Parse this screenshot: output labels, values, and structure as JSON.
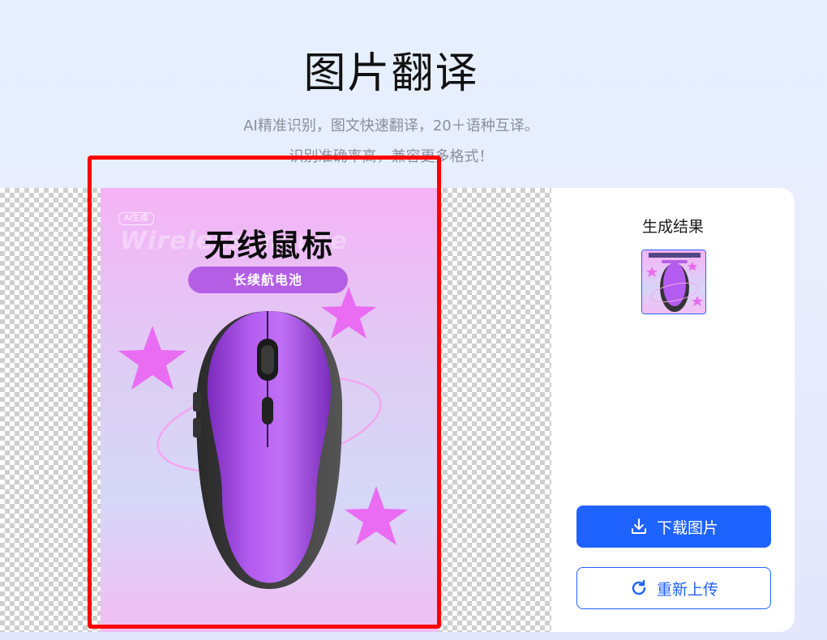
{
  "header": {
    "title": "图片翻译",
    "subtitle_line1": "AI精准识别，图文快速翻译，20＋语种互译。",
    "subtitle_line2": "识别准确率高，兼容更多格式！"
  },
  "poster": {
    "badge": "AI生成",
    "ghost_text": "Wireless mouse",
    "headline": "无线鼠标",
    "pill": "长续航电池"
  },
  "result_panel": {
    "title": "生成结果",
    "download_label": "下载图片",
    "reupload_label": "重新上传"
  },
  "colors": {
    "accent": "#1f63ff",
    "selection": "#ff0000",
    "poster_pink": "#f7b4f7",
    "mouse_purple": "#a84fe0"
  },
  "icons": {
    "download": "download-icon",
    "reupload": "refresh-icon"
  }
}
